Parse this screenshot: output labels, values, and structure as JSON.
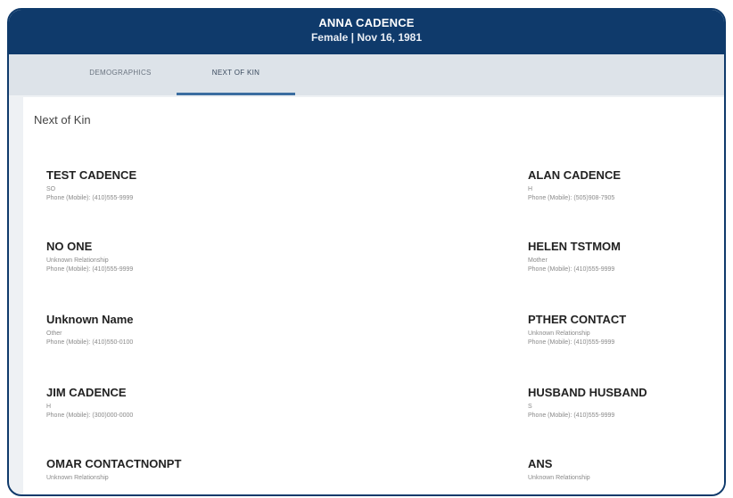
{
  "patient": {
    "name": "ANNA CADENCE",
    "details": "Female | Nov 16, 1981"
  },
  "tabs": [
    {
      "label": "DEMOGRAPHICS",
      "active": false
    },
    {
      "label": "NEXT OF KIN",
      "active": true
    }
  ],
  "section": {
    "title": "Next of Kin"
  },
  "contacts_left": [
    {
      "name": "TEST CADENCE",
      "relationship": "SO",
      "phone": "Phone (Mobile): (410)555-9999"
    },
    {
      "name": "NO ONE",
      "relationship": "Unknown Relationship",
      "phone": "Phone (Mobile): (410)555-9999"
    },
    {
      "name": "Unknown Name",
      "relationship": "Other",
      "phone": "Phone (Mobile): (410)550-0100"
    },
    {
      "name": "JIM CADENCE",
      "relationship": "H",
      "phone": "Phone (Mobile): (300)000-0000"
    },
    {
      "name": "OMAR CONTACTNONPT",
      "relationship": "Unknown Relationship",
      "phone": ""
    }
  ],
  "contacts_right": [
    {
      "name": "ALAN CADENCE",
      "relationship": "H",
      "phone": "Phone (Mobile): (505)908-7905"
    },
    {
      "name": "HELEN TSTMOM",
      "relationship": "Mother",
      "phone": "Phone (Mobile): (410)555-9999"
    },
    {
      "name": "PTHER CONTACT",
      "relationship": "Unknown Relationship",
      "phone": "Phone (Mobile): (410)555-9999"
    },
    {
      "name": "HUSBAND HUSBAND",
      "relationship": "S",
      "phone": "Phone (Mobile): (410)555-9999"
    },
    {
      "name": "ANS",
      "relationship": "Unknown Relationship",
      "phone": ""
    }
  ],
  "colors": {
    "header_bg": "#0f3a6b",
    "tab_bar_bg": "#dde3e9",
    "active_tab_underline": "#3b6da0"
  }
}
